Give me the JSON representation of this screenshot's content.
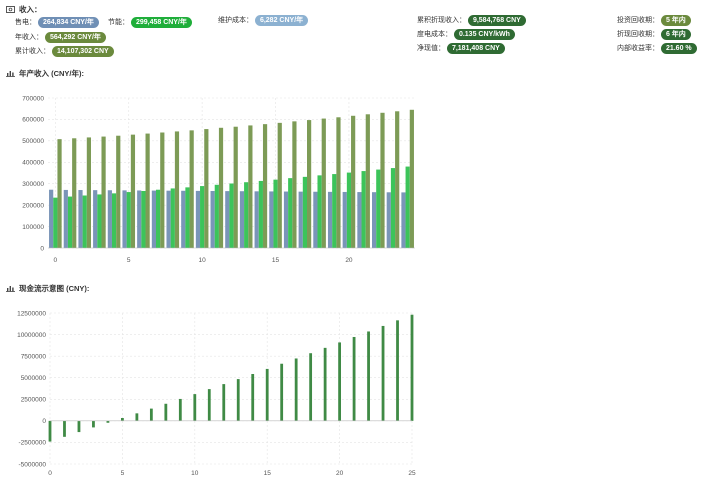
{
  "income": {
    "title": "收入：",
    "items": [
      {
        "label": "售电：",
        "value": "264,834 CNY/年"
      },
      {
        "label": "节能：",
        "value": "299,458 CNY/年"
      },
      {
        "label": "年收入：",
        "value": "564,292 CNY/年"
      },
      {
        "label": "累计收入：",
        "value": "14,107,302 CNY"
      }
    ]
  },
  "maintenance": {
    "label": "维护成本：",
    "value": "6,282 CNY/年"
  },
  "metrics": [
    {
      "label": "累积折现收入：",
      "value": "9,584,768 CNY"
    },
    {
      "label": "度电成本：",
      "value": "0.135 CNY/kWh"
    },
    {
      "label": "净现值：",
      "value": "7,181,408 CNY"
    }
  ],
  "payback": [
    {
      "label": "投资回收期：",
      "value": "5 年内"
    },
    {
      "label": "折现回收期：",
      "value": "6 年内"
    },
    {
      "label": "内部收益率：",
      "value": "21.60 %"
    }
  ],
  "chart_titles": {
    "annual": "年产收入 (CNY/年):",
    "cash": "现金流示意图 (CNY):"
  },
  "colors": {
    "series_blue": "#7a95b8",
    "series_green": "#3cc45a",
    "series_olive": "#7d9b56",
    "cash_green": "#3f8a45"
  },
  "chart_data": [
    {
      "type": "bar",
      "title": "年产收入 (CNY/年):",
      "xlabel": "",
      "ylabel": "",
      "x": [
        0,
        1,
        2,
        3,
        4,
        5,
        6,
        7,
        8,
        9,
        10,
        11,
        12,
        13,
        14,
        15,
        16,
        17,
        18,
        19,
        20,
        21,
        22,
        23,
        24
      ],
      "xticks": [
        0,
        5,
        10,
        15,
        20
      ],
      "ylim": [
        0,
        700000
      ],
      "yticks": [
        0,
        100000,
        200000,
        300000,
        400000,
        500000,
        600000,
        700000
      ],
      "series": [
        {
          "color": "#7a95b8",
          "values": [
            272000,
            271000,
            270500,
            270000,
            269500,
            269000,
            268500,
            268000,
            267500,
            267000,
            266500,
            266000,
            265500,
            265000,
            264500,
            264000,
            263500,
            263000,
            262500,
            262000,
            261500,
            261000,
            260500,
            260000,
            259500
          ]
        },
        {
          "color": "#3cc45a",
          "values": [
            235000,
            240000,
            245000,
            250000,
            255000,
            261000,
            266000,
            272000,
            278000,
            283000,
            289000,
            295000,
            301000,
            307000,
            313000,
            319000,
            326000,
            332000,
            339000,
            345000,
            352000,
            359000,
            366000,
            373000,
            380000
          ]
        },
        {
          "color": "#7d9b56",
          "values": [
            508000,
            512000,
            516000,
            520000,
            524000,
            529000,
            534000,
            539000,
            544000,
            549000,
            555000,
            561000,
            566000,
            572000,
            578000,
            584000,
            591000,
            597000,
            604000,
            610000,
            617000,
            624000,
            631000,
            638000,
            645000
          ]
        }
      ],
      "grid": true
    },
    {
      "type": "bar",
      "title": "现金流示意图 (CNY):",
      "xlabel": "",
      "ylabel": "",
      "x": [
        0,
        1,
        2,
        3,
        4,
        5,
        6,
        7,
        8,
        9,
        10,
        11,
        12,
        13,
        14,
        15,
        16,
        17,
        18,
        19,
        20,
        21,
        22,
        23,
        24,
        25
      ],
      "xticks": [
        0,
        5,
        10,
        15,
        20,
        25
      ],
      "ylim": [
        -5000000,
        12500000
      ],
      "yticks": [
        -5000000,
        -2500000,
        0,
        2500000,
        5000000,
        7500000,
        10000000,
        12500000
      ],
      "series": [
        {
          "color": "#3f8a45",
          "values": [
            -2400000,
            -1850000,
            -1300000,
            -760000,
            -220000,
            330000,
            870000,
            1420000,
            1980000,
            2540000,
            3100000,
            3680000,
            4260000,
            4840000,
            5430000,
            6020000,
            6620000,
            7230000,
            7840000,
            8460000,
            9090000,
            9720000,
            10360000,
            11000000,
            11650000,
            12300000
          ]
        }
      ],
      "grid": true
    }
  ]
}
